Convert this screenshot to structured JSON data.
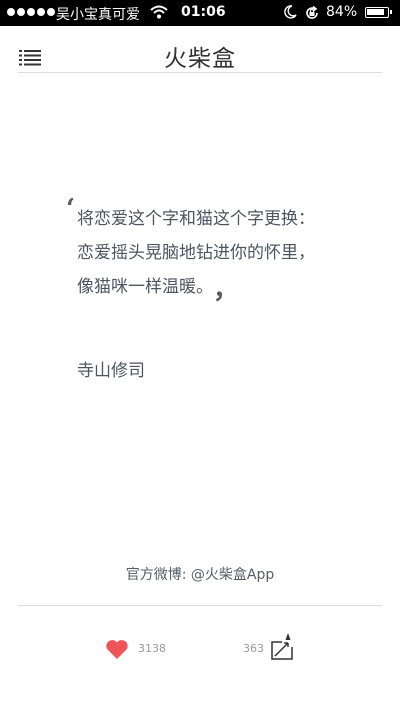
{
  "status_bar": {
    "carrier": "吴小宝真可爱",
    "time": "01:06",
    "battery": "84%"
  },
  "nav": {
    "title": "火柴盒",
    "menu_icon": "list-icon"
  },
  "quote": {
    "open_mark": "‘",
    "lines": [
      "将恋爱这个字和猫这个字更换：",
      "恋爱摇头晃脑地钻进你的怀里，",
      "像猫咪一样温暖。"
    ],
    "close_mark": "，",
    "author": "寺山修司"
  },
  "footer": {
    "weibo": "官方微博: @火柴盒App",
    "likes": "3138",
    "shares": "363"
  },
  "colors": {
    "heart": "#f0535a",
    "text": "#4c5660"
  }
}
